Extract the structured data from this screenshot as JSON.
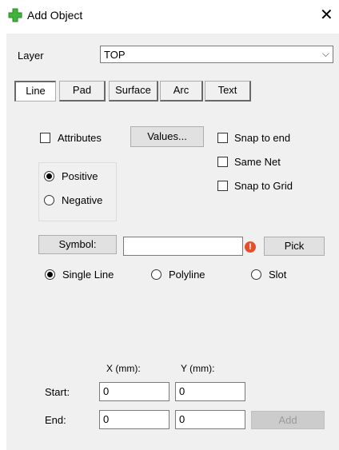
{
  "window": {
    "title": "Add Object",
    "close_glyph": "✕",
    "icon": "green-plus-icon",
    "icon_color": "#3fb33a"
  },
  "layer": {
    "label": "Layer",
    "value": "TOP",
    "arrow": "⌵"
  },
  "tabs": [
    {
      "label": "Line",
      "active": true
    },
    {
      "label": "Pad"
    },
    {
      "label": "Surface"
    },
    {
      "label": "Arc"
    },
    {
      "label": "Text"
    }
  ],
  "attributes": {
    "label": "Attributes",
    "checked": false
  },
  "values_button": "Values...",
  "snap_to_end": {
    "label": "Snap to end",
    "checked": false
  },
  "same_net": {
    "label": "Same Net",
    "checked": false
  },
  "snap_to_grid": {
    "label": "Snap to Grid",
    "checked": false
  },
  "polarity": {
    "positive": {
      "label": "Positive",
      "checked": true
    },
    "negative": {
      "label": "Negative",
      "checked": false
    }
  },
  "symbol": {
    "button": "Symbol:",
    "value": "",
    "warning_glyph": "!",
    "warning_color": "#e2502d",
    "pick_button": "Pick"
  },
  "line_type": {
    "single_line": {
      "label": "Single Line",
      "checked": true
    },
    "polyline": {
      "label": "Polyline",
      "checked": false
    },
    "slot": {
      "label": "Slot",
      "checked": false
    }
  },
  "coords": {
    "x_header": "X (mm):",
    "y_header": "Y (mm):",
    "start_label": "Start:",
    "end_label": "End:",
    "start_x": "0",
    "start_y": "0",
    "end_x": "0",
    "end_y": "0",
    "add_button": "Add"
  }
}
